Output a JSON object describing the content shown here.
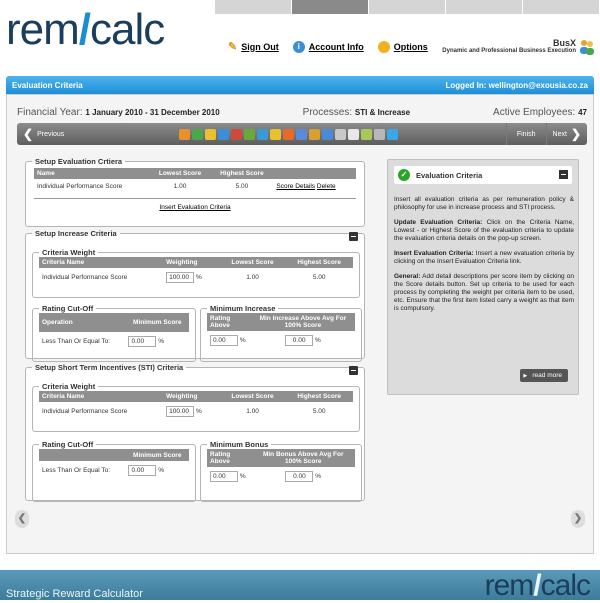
{
  "brand": {
    "logo_left": "rem",
    "logo_slash": "/",
    "logo_right": "calc"
  },
  "header": {
    "sign_out": "Sign Out",
    "account_info": "Account Info",
    "options": "Options",
    "company_name": "BusX",
    "company_tag": "Dynamic and Professional Business Execution"
  },
  "title_bar": {
    "title": "Evaluation Criteria",
    "logged_in": "Logged In: wellington@exousia.co.za"
  },
  "info": {
    "fy_label": "Financial Year:",
    "fy_value": "1 January 2010 - 31 December 2010",
    "proc_label": "Processes:",
    "proc_value": "STI & Increase",
    "emp_label": "Active Employees:",
    "emp_value": "47"
  },
  "toolbar": {
    "previous": "Previous",
    "finish": "Finish",
    "next": "Next"
  },
  "eval": {
    "legend": "Setup Evaluation Crtiera",
    "headers": [
      "Name",
      "Lowest Score",
      "Highest Score"
    ],
    "row": {
      "name": "Individual Performance Score",
      "low": "1.00",
      "high": "5.00",
      "details": "Score Details",
      "delete": "Delete"
    },
    "insert": "Insert Evaluation Criteria"
  },
  "increase": {
    "legend": "Setup Increase Criteria",
    "cw_legend": "Criteria Weight",
    "cw_headers": [
      "Criteria Name",
      "Weighting",
      "Lowest Score",
      "Highest Score"
    ],
    "cw_row": {
      "name": "Individual Performance Score",
      "weight": "100.00",
      "pct": "%",
      "low": "1.00",
      "high": "5.00"
    },
    "rc_legend": "Rating Cut-Off",
    "rc_headers": [
      "Operation",
      "Minimum Score"
    ],
    "rc_row": {
      "op": "Less Than Or Equal To:",
      "val": "0.00",
      "pct": "%"
    },
    "mi_legend": "Minimum Increase",
    "mi_headers": [
      "Rating Above",
      "Min Increase Above Avg For 100% Score"
    ],
    "mi_row": {
      "a": "0.00",
      "pa": "%",
      "b": "0.00",
      "pb": "%"
    }
  },
  "sti": {
    "legend": "Setup Short Term Incentives (STI) Criteria",
    "cw_legend": "Criteria Weight",
    "cw_headers": [
      "Criteria Name",
      "Weighting",
      "Lowest Score",
      "Highest Score"
    ],
    "cw_row": {
      "name": "Individual Performance Score",
      "weight": "100.00",
      "pct": "%",
      "low": "1.00",
      "high": "5.00"
    },
    "rc_legend": "Rating Cut-Off",
    "rc_headers": [
      "",
      "Minimum Score"
    ],
    "rc_row": {
      "op": "Less Than Or Equal To:",
      "val": "0.00",
      "pct": "%"
    },
    "mb_legend": "Minimum Bonus",
    "mb_headers": [
      "Rating Above",
      "Min Bonus Above Avg For 100% Score"
    ],
    "mb_row": {
      "a": "0.00",
      "pa": "%",
      "b": "0.00",
      "pb": "%"
    }
  },
  "help": {
    "title": "Evaluation Criteria",
    "p1": "Insert all evaluation criteria as per remuneration policy & philosophy for use in increase process and STI process.",
    "p2_head": "Update Evaluation Criteria:",
    "p2": " Click on the Criteria Name, Lowest - or Highest Score of the evaluation criteria to update the evaluation criteria details on the pop-up screen.",
    "p3_head": "Insert Evaluation Criteria:",
    "p3": " Insert a new evaluation criteria by clicking on the Insert Evaluation Criteria link.",
    "p4_head": "General:",
    "p4": " Add detail descriptions per score item by clicking on the Score details button. Set up criteria to be used for each process by completing the weight per criteria item to be used, etc. Ensure that the first item listed carry a weight as that item is compulsory.",
    "read_more": "read more"
  },
  "footer": {
    "text": "Strategic Reward Calculator"
  },
  "colors": {
    "accent": "#1e8ed6",
    "header_grey": "#8f8f8f"
  },
  "toolbar_icons": [
    "chart-icon",
    "pie-icon",
    "people-icon",
    "briefcase-icon",
    "pencil-icon",
    "grid-icon",
    "graph-icon",
    "star-icon",
    "globe-icon",
    "users-icon",
    "users2-icon",
    "users3-icon",
    "clock-icon",
    "mail-icon",
    "card-icon",
    "gear-icon",
    "play-icon"
  ]
}
